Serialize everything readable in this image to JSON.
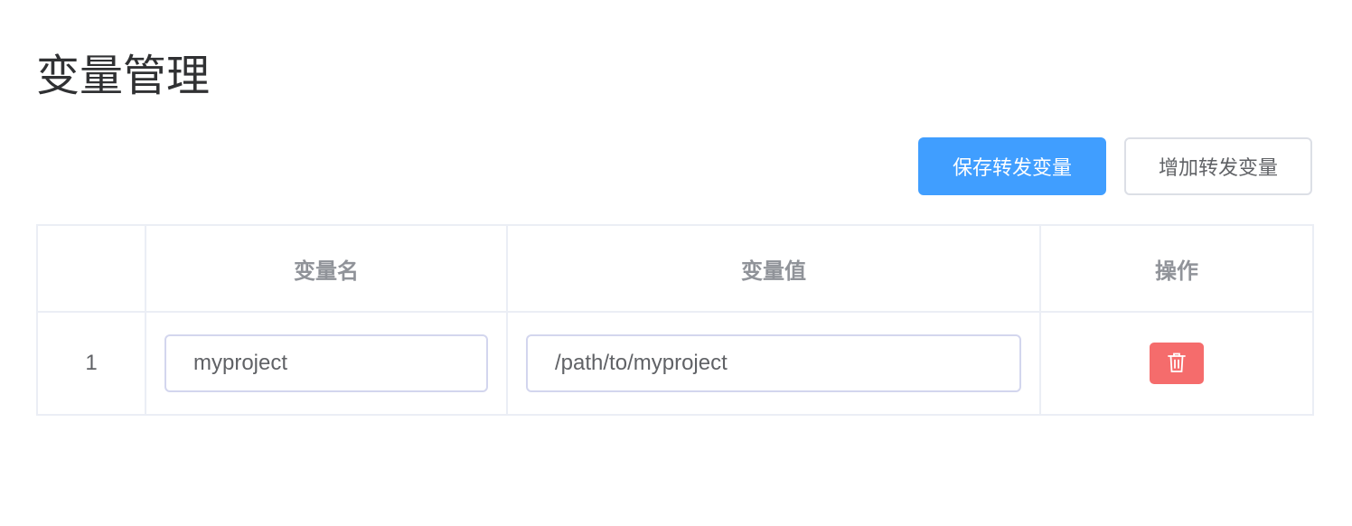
{
  "page": {
    "title": "变量管理"
  },
  "toolbar": {
    "save_label": "保存转发变量",
    "add_label": "增加转发变量"
  },
  "table": {
    "columns": [
      "",
      "变量名",
      "变量值",
      "操作"
    ],
    "rows": [
      {
        "index": "1",
        "name": "myproject",
        "value": "/path/to/myproject",
        "action_icon": "trash-icon"
      }
    ]
  },
  "colors": {
    "primary": "#409eff",
    "danger": "#f56c6c",
    "border": "#ebeef5"
  }
}
